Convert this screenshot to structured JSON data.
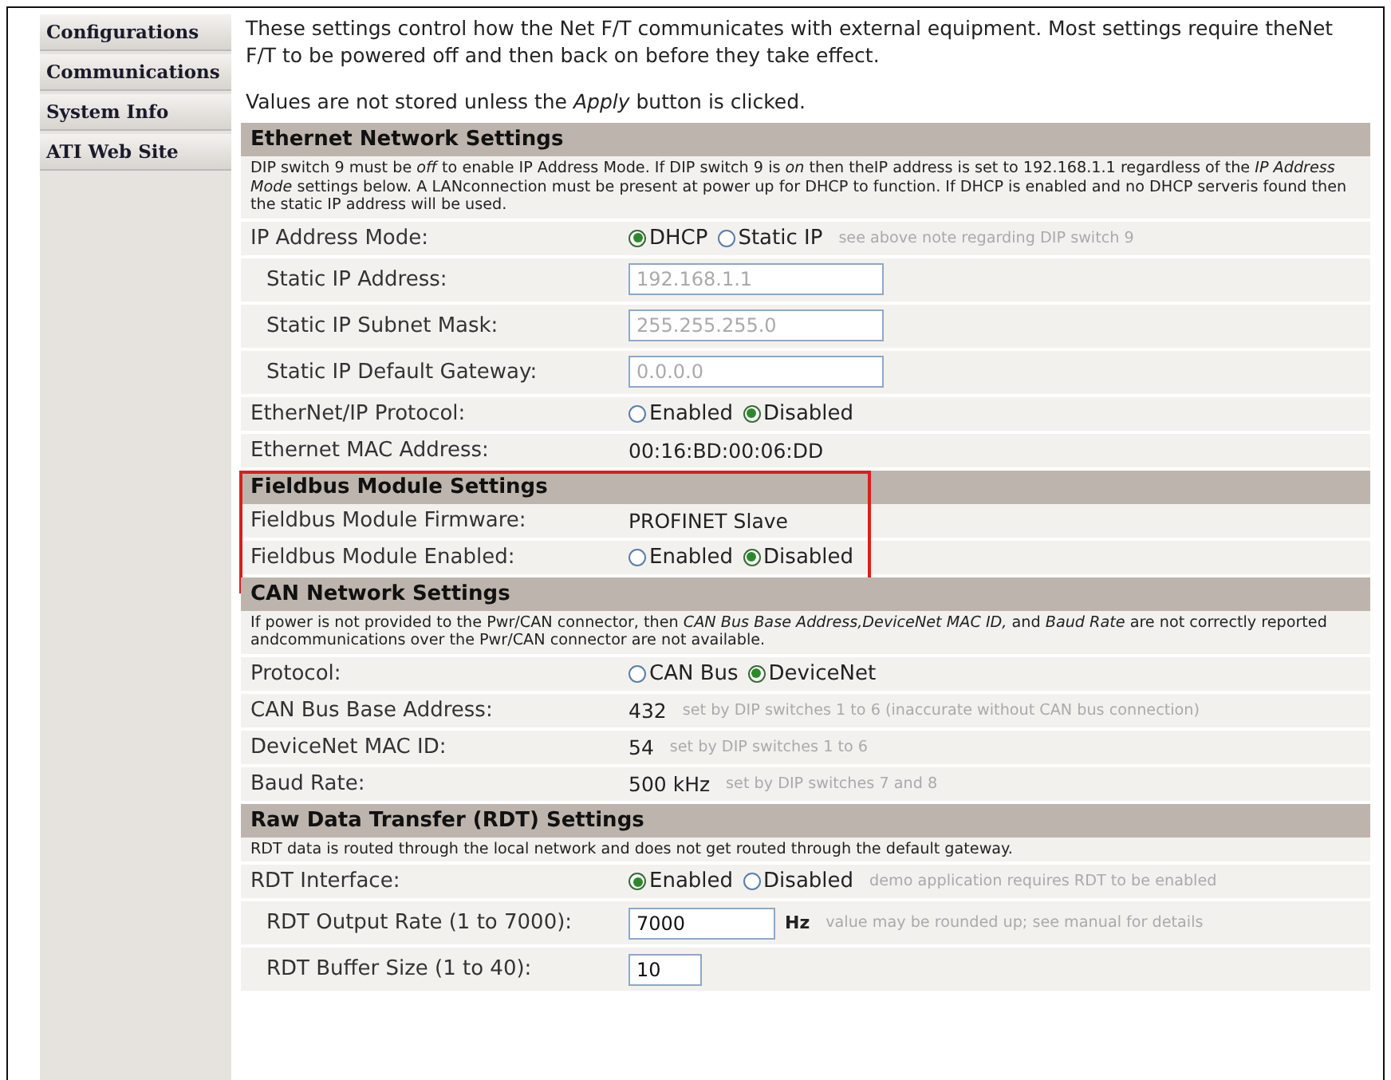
{
  "sidebar": {
    "items": [
      {
        "label": "Configurations"
      },
      {
        "label": "Communications"
      },
      {
        "label": "System Info"
      },
      {
        "label": "ATI Web Site"
      }
    ]
  },
  "intro": [
    "These settings control how the Net F/T communicates with external equipment. Most settings require theNet F/T to be powered off and then back on before they take effect.",
    "Values are not stored unless the *Apply* button is clicked."
  ],
  "sections": [
    {
      "title": "Ethernet Network Settings",
      "highlighted": false,
      "note": "DIP switch 9 must be *off* to enable IP Address Mode. If DIP switch 9 is *on* then theIP address is set to 192.168.1.1 regardless of the *IP Address Mode* settings below. A LANconnection must be present at power up for DHCP to function. If DHCP is enabled and no DHCP serveris found then the static IP address will be used.",
      "rows": [
        {
          "kind": "radio",
          "label": "IP Address Mode:",
          "options": [
            {
              "label": "DHCP",
              "selected": true
            },
            {
              "label": "Static IP",
              "selected": false
            }
          ],
          "hint": "see above note regarding DIP switch 9"
        },
        {
          "kind": "input",
          "label": "Static IP Address:",
          "value": "192.168.1.1",
          "disabled": true
        },
        {
          "kind": "input",
          "label": "Static IP Subnet Mask:",
          "value": "255.255.255.0",
          "disabled": true
        },
        {
          "kind": "input",
          "label": "Static IP Default Gateway:",
          "value": "0.0.0.0",
          "disabled": true
        },
        {
          "kind": "radio",
          "label": "EtherNet/IP Protocol:",
          "options": [
            {
              "label": "Enabled",
              "selected": false
            },
            {
              "label": "Disabled",
              "selected": true
            }
          ]
        },
        {
          "kind": "text",
          "label": "Ethernet MAC Address:",
          "value": "00:16:BD:00:06:DD"
        }
      ]
    },
    {
      "title": "Fieldbus Module Settings",
      "highlighted": true,
      "rows": [
        {
          "kind": "text",
          "label": "Fieldbus Module Firmware:",
          "value": "PROFINET Slave"
        },
        {
          "kind": "radio",
          "label": "Fieldbus Module Enabled:",
          "options": [
            {
              "label": "Enabled",
              "selected": false
            },
            {
              "label": "Disabled",
              "selected": true
            }
          ]
        }
      ]
    },
    {
      "title": "CAN Network Settings",
      "highlighted": false,
      "note": "If power is not provided to the Pwr/CAN connector, then *CAN Bus Base Address,DeviceNet MAC ID,* and *Baud Rate* are not correctly reported andcommunications over the Pwr/CAN connector are not available.",
      "rows": [
        {
          "kind": "radio",
          "label": "Protocol:",
          "options": [
            {
              "label": "CAN Bus",
              "selected": false
            },
            {
              "label": "DeviceNet",
              "selected": true
            }
          ]
        },
        {
          "kind": "text",
          "label": "CAN Bus Base Address:",
          "value": "432",
          "hint": "set by DIP switches 1 to 6 (inaccurate without CAN bus connection)"
        },
        {
          "kind": "text",
          "label": "DeviceNet MAC ID:",
          "value": "54",
          "hint": "set by DIP switches 1 to 6"
        },
        {
          "kind": "text",
          "label": "Baud Rate:",
          "value": "500 kHz",
          "hint": "set by DIP switches 7 and 8"
        }
      ]
    },
    {
      "title": "Raw Data Transfer (RDT) Settings",
      "highlighted": false,
      "note": "RDT data is routed through the local network and does not get routed through the default gateway.",
      "rows": [
        {
          "kind": "radio",
          "label": "RDT Interface:",
          "options": [
            {
              "label": "Enabled",
              "selected": true
            },
            {
              "label": "Disabled",
              "selected": false
            }
          ],
          "hint": "demo application requires RDT to be enabled"
        },
        {
          "kind": "input",
          "label": "RDT Output Rate (1 to 7000):",
          "value": "7000",
          "disabled": false,
          "unit": "Hz",
          "hint": "value may be rounded up; see manual for details"
        },
        {
          "kind": "input",
          "label": "RDT Buffer Size (1 to 40):",
          "value": "10",
          "disabled": false
        }
      ]
    }
  ]
}
